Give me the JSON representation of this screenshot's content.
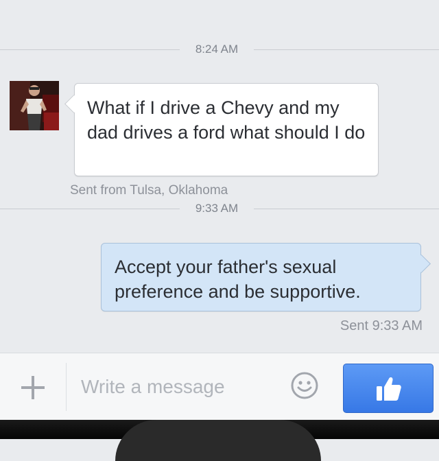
{
  "thread": {
    "timestamps": [
      "8:24 AM",
      "9:33 AM"
    ],
    "incoming": {
      "text": "What if I drive a Chevy and my dad drives a ford what should I do",
      "meta": "Sent from Tulsa, Oklahoma"
    },
    "outgoing": {
      "text": "Accept your father's sexual preference and be supportive.",
      "meta": "Sent 9:33 AM"
    }
  },
  "composer": {
    "placeholder": "Write a message",
    "value": "",
    "icons": {
      "attach": "plus-icon",
      "emoji": "smiley-icon",
      "like": "thumbs-up-icon"
    }
  },
  "colors": {
    "incoming_bubble": "#ffffff",
    "outgoing_bubble": "#d3e5f7",
    "like_button": "#3f82ed",
    "background": "#e9ebee"
  }
}
